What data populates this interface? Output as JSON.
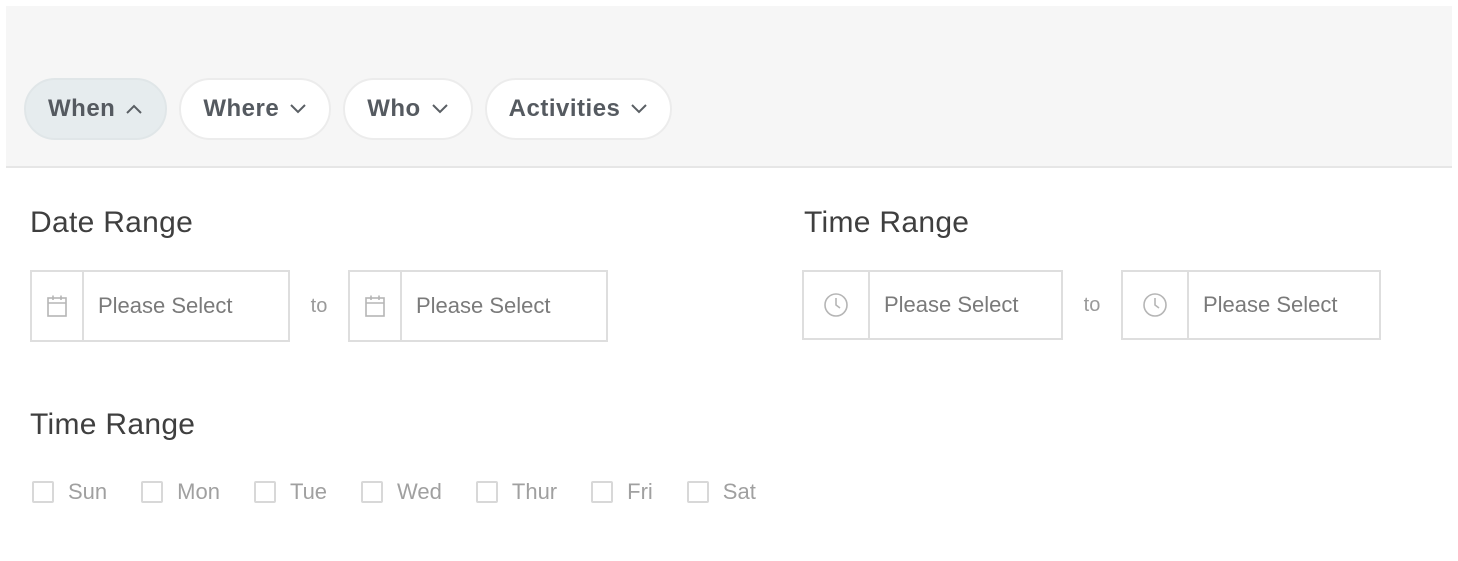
{
  "filters": {
    "tabs": [
      {
        "label": "When",
        "state": "expanded"
      },
      {
        "label": "Where",
        "state": "collapsed"
      },
      {
        "label": "Who",
        "state": "collapsed"
      },
      {
        "label": "Activities",
        "state": "collapsed"
      }
    ]
  },
  "date_range": {
    "title": "Date Range",
    "start_placeholder": "Please Select",
    "separator": "to",
    "end_placeholder": "Please Select",
    "icon": "calendar-icon"
  },
  "time_range": {
    "title": "Time Range",
    "start_placeholder": "Please Select",
    "separator": "to",
    "end_placeholder": "Please Select",
    "icon": "clock-icon"
  },
  "weekdays": {
    "title": "Time Range",
    "days": [
      {
        "label": "Sun",
        "checked": false
      },
      {
        "label": "Mon",
        "checked": false
      },
      {
        "label": "Tue",
        "checked": false
      },
      {
        "label": "Wed",
        "checked": false
      },
      {
        "label": "Thur",
        "checked": false
      },
      {
        "label": "Fri",
        "checked": false
      },
      {
        "label": "Sat",
        "checked": false
      }
    ]
  },
  "colors": {
    "active_tab_bg": "#e6ecee",
    "bar_bg": "#f6f6f6",
    "border": "#dedede"
  }
}
